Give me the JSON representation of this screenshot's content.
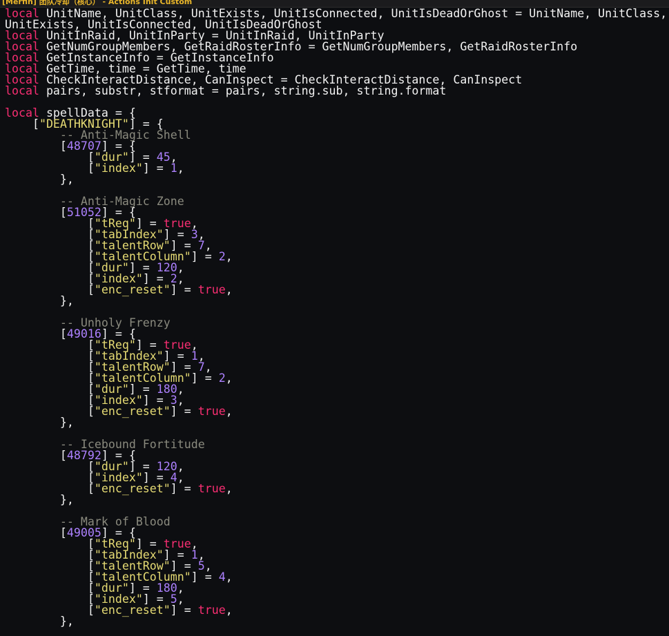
{
  "window": {
    "title": "[Merfin] 团队冷却（核心） - Actions Init Custom"
  },
  "colors": {
    "keyword": "#f92e72",
    "string": "#e6db74",
    "number": "#ad81ff",
    "comment": "#8a8a7e",
    "text": "#f2f2f2",
    "background": "#0d0e11",
    "title": "#e9b62a"
  },
  "code_lines": [
    [
      [
        "kw",
        "local"
      ],
      [
        "pn",
        " UnitName, UnitClass, UnitExists, UnitIsConnected, UnitIsDeadOrGhost = UnitName, UnitClass,"
      ]
    ],
    [
      [
        "pn",
        "UnitExists, UnitIsConnected, UnitIsDeadOrGhost"
      ]
    ],
    [
      [
        "kw",
        "local"
      ],
      [
        "pn",
        " UnitInRaid, UnitInParty = UnitInRaid, UnitInParty"
      ]
    ],
    [
      [
        "kw",
        "local"
      ],
      [
        "pn",
        " GetNumGroupMembers, GetRaidRosterInfo = GetNumGroupMembers, GetRaidRosterInfo"
      ]
    ],
    [
      [
        "kw",
        "local"
      ],
      [
        "pn",
        " GetInstanceInfo = GetInstanceInfo"
      ]
    ],
    [
      [
        "kw",
        "local"
      ],
      [
        "pn",
        " GetTime, time = GetTime, time"
      ]
    ],
    [
      [
        "kw",
        "local"
      ],
      [
        "pn",
        " CheckInteractDistance, CanInspect = CheckInteractDistance, CanInspect"
      ]
    ],
    [
      [
        "kw",
        "local"
      ],
      [
        "pn",
        " pairs, substr, stformat = pairs, string.sub, string.format"
      ]
    ],
    [],
    [
      [
        "kw",
        "local"
      ],
      [
        "pn",
        " spellData = {"
      ]
    ],
    [
      [
        "pn",
        "    ["
      ],
      [
        "str",
        "\"DEATHKNIGHT\""
      ],
      [
        "pn",
        "] = {"
      ]
    ],
    [
      [
        "cmt",
        "        -- Anti-Magic Shell"
      ]
    ],
    [
      [
        "pn",
        "        ["
      ],
      [
        "num",
        "48707"
      ],
      [
        "pn",
        "] = {"
      ]
    ],
    [
      [
        "pn",
        "            ["
      ],
      [
        "str",
        "\"dur\""
      ],
      [
        "pn",
        "] = "
      ],
      [
        "num",
        "45"
      ],
      [
        "pn",
        ","
      ]
    ],
    [
      [
        "pn",
        "            ["
      ],
      [
        "str",
        "\"index\""
      ],
      [
        "pn",
        "] = "
      ],
      [
        "num",
        "1"
      ],
      [
        "pn",
        ","
      ]
    ],
    [
      [
        "pn",
        "        },"
      ]
    ],
    [],
    [
      [
        "cmt",
        "        -- Anti-Magic Zone"
      ]
    ],
    [
      [
        "pn",
        "        ["
      ],
      [
        "num",
        "51052"
      ],
      [
        "pn",
        "] = {"
      ]
    ],
    [
      [
        "pn",
        "            ["
      ],
      [
        "str",
        "\"tReq\""
      ],
      [
        "pn",
        "] = "
      ],
      [
        "bool",
        "true"
      ],
      [
        "pn",
        ","
      ]
    ],
    [
      [
        "pn",
        "            ["
      ],
      [
        "str",
        "\"tabIndex\""
      ],
      [
        "pn",
        "] = "
      ],
      [
        "num",
        "3"
      ],
      [
        "pn",
        ","
      ]
    ],
    [
      [
        "pn",
        "            ["
      ],
      [
        "str",
        "\"talentRow\""
      ],
      [
        "pn",
        "] = "
      ],
      [
        "num",
        "7"
      ],
      [
        "pn",
        ","
      ]
    ],
    [
      [
        "pn",
        "            ["
      ],
      [
        "str",
        "\"talentColumn\""
      ],
      [
        "pn",
        "] = "
      ],
      [
        "num",
        "2"
      ],
      [
        "pn",
        ","
      ]
    ],
    [
      [
        "pn",
        "            ["
      ],
      [
        "str",
        "\"dur\""
      ],
      [
        "pn",
        "] = "
      ],
      [
        "num",
        "120"
      ],
      [
        "pn",
        ","
      ]
    ],
    [
      [
        "pn",
        "            ["
      ],
      [
        "str",
        "\"index\""
      ],
      [
        "pn",
        "] = "
      ],
      [
        "num",
        "2"
      ],
      [
        "pn",
        ","
      ]
    ],
    [
      [
        "pn",
        "            ["
      ],
      [
        "str",
        "\"enc_reset\""
      ],
      [
        "pn",
        "] = "
      ],
      [
        "bool",
        "true"
      ],
      [
        "pn",
        ","
      ]
    ],
    [
      [
        "pn",
        "        },"
      ]
    ],
    [],
    [
      [
        "cmt",
        "        -- Unholy Frenzy"
      ]
    ],
    [
      [
        "pn",
        "        ["
      ],
      [
        "num",
        "49016"
      ],
      [
        "pn",
        "] = {"
      ]
    ],
    [
      [
        "pn",
        "            ["
      ],
      [
        "str",
        "\"tReq\""
      ],
      [
        "pn",
        "] = "
      ],
      [
        "bool",
        "true"
      ],
      [
        "pn",
        ","
      ]
    ],
    [
      [
        "pn",
        "            ["
      ],
      [
        "str",
        "\"tabIndex\""
      ],
      [
        "pn",
        "] = "
      ],
      [
        "num",
        "1"
      ],
      [
        "pn",
        ","
      ]
    ],
    [
      [
        "pn",
        "            ["
      ],
      [
        "str",
        "\"talentRow\""
      ],
      [
        "pn",
        "] = "
      ],
      [
        "num",
        "7"
      ],
      [
        "pn",
        ","
      ]
    ],
    [
      [
        "pn",
        "            ["
      ],
      [
        "str",
        "\"talentColumn\""
      ],
      [
        "pn",
        "] = "
      ],
      [
        "num",
        "2"
      ],
      [
        "pn",
        ","
      ]
    ],
    [
      [
        "pn",
        "            ["
      ],
      [
        "str",
        "\"dur\""
      ],
      [
        "pn",
        "] = "
      ],
      [
        "num",
        "180"
      ],
      [
        "pn",
        ","
      ]
    ],
    [
      [
        "pn",
        "            ["
      ],
      [
        "str",
        "\"index\""
      ],
      [
        "pn",
        "] = "
      ],
      [
        "num",
        "3"
      ],
      [
        "pn",
        ","
      ]
    ],
    [
      [
        "pn",
        "            ["
      ],
      [
        "str",
        "\"enc_reset\""
      ],
      [
        "pn",
        "] = "
      ],
      [
        "bool",
        "true"
      ],
      [
        "pn",
        ","
      ]
    ],
    [
      [
        "pn",
        "        },"
      ]
    ],
    [],
    [
      [
        "cmt",
        "        -- Icebound Fortitude"
      ]
    ],
    [
      [
        "pn",
        "        ["
      ],
      [
        "num",
        "48792"
      ],
      [
        "pn",
        "] = {"
      ]
    ],
    [
      [
        "pn",
        "            ["
      ],
      [
        "str",
        "\"dur\""
      ],
      [
        "pn",
        "] = "
      ],
      [
        "num",
        "120"
      ],
      [
        "pn",
        ","
      ]
    ],
    [
      [
        "pn",
        "            ["
      ],
      [
        "str",
        "\"index\""
      ],
      [
        "pn",
        "] = "
      ],
      [
        "num",
        "4"
      ],
      [
        "pn",
        ","
      ]
    ],
    [
      [
        "pn",
        "            ["
      ],
      [
        "str",
        "\"enc_reset\""
      ],
      [
        "pn",
        "] = "
      ],
      [
        "bool",
        "true"
      ],
      [
        "pn",
        ","
      ]
    ],
    [
      [
        "pn",
        "        },"
      ]
    ],
    [],
    [
      [
        "cmt",
        "        -- Mark of Blood"
      ]
    ],
    [
      [
        "pn",
        "        ["
      ],
      [
        "num",
        "49005"
      ],
      [
        "pn",
        "] = {"
      ]
    ],
    [
      [
        "pn",
        "            ["
      ],
      [
        "str",
        "\"tReq\""
      ],
      [
        "pn",
        "] = "
      ],
      [
        "bool",
        "true"
      ],
      [
        "pn",
        ","
      ]
    ],
    [
      [
        "pn",
        "            ["
      ],
      [
        "str",
        "\"tabIndex\""
      ],
      [
        "pn",
        "] = "
      ],
      [
        "num",
        "1"
      ],
      [
        "pn",
        ","
      ]
    ],
    [
      [
        "pn",
        "            ["
      ],
      [
        "str",
        "\"talentRow\""
      ],
      [
        "pn",
        "] = "
      ],
      [
        "num",
        "5"
      ],
      [
        "pn",
        ","
      ]
    ],
    [
      [
        "pn",
        "            ["
      ],
      [
        "str",
        "\"talentColumn\""
      ],
      [
        "pn",
        "] = "
      ],
      [
        "num",
        "4"
      ],
      [
        "pn",
        ","
      ]
    ],
    [
      [
        "pn",
        "            ["
      ],
      [
        "str",
        "\"dur\""
      ],
      [
        "pn",
        "] = "
      ],
      [
        "num",
        "180"
      ],
      [
        "pn",
        ","
      ]
    ],
    [
      [
        "pn",
        "            ["
      ],
      [
        "str",
        "\"index\""
      ],
      [
        "pn",
        "] = "
      ],
      [
        "num",
        "5"
      ],
      [
        "pn",
        ","
      ]
    ],
    [
      [
        "pn",
        "            ["
      ],
      [
        "str",
        "\"enc_reset\""
      ],
      [
        "pn",
        "] = "
      ],
      [
        "bool",
        "true"
      ],
      [
        "pn",
        ","
      ]
    ],
    [
      [
        "pn",
        "        },"
      ]
    ]
  ]
}
